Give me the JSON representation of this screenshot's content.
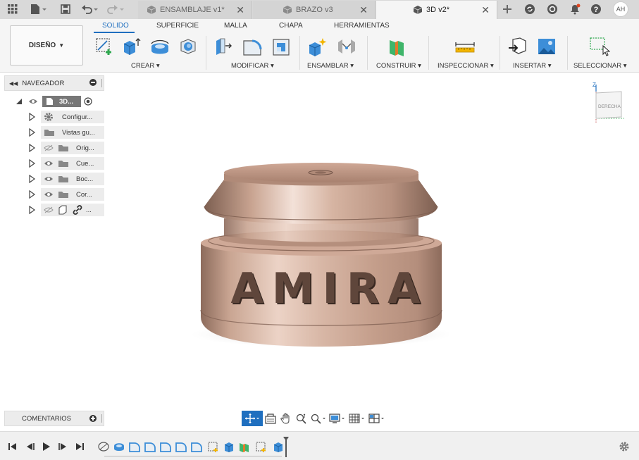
{
  "tabs": [
    {
      "label": "ENSAMBLAJE v1*",
      "active": false
    },
    {
      "label": "BRAZO v3",
      "active": false
    },
    {
      "label": "3D v2*",
      "active": true
    }
  ],
  "user": {
    "initials": "AH"
  },
  "workspace": {
    "label": "DISEÑO"
  },
  "ribbon_tabs": [
    "SOLIDO",
    "SUPERFICIE",
    "MALLA",
    "CHAPA",
    "HERRAMIENTAS"
  ],
  "ribbon_groups": {
    "crear": "CREAR",
    "modificar": "MODIFICAR",
    "ensamblar": "ENSAMBLAR",
    "construir": "CONSTRUIR",
    "inspeccionar": "INSPECCIONAR",
    "insertar": "INSERTAR",
    "seleccionar": "SELECCIONAR"
  },
  "navigator": {
    "title": "NAVEGADOR",
    "root": "3D...",
    "items": [
      {
        "label": "Configur...",
        "icon": "gear-icon"
      },
      {
        "label": "Vistas gu...",
        "icon": "folder-icon"
      },
      {
        "label": "Orig...",
        "icon": "folder-icon"
      },
      {
        "label": "Cue...",
        "icon": "folder-icon"
      },
      {
        "label": "Boc...",
        "icon": "folder-icon"
      },
      {
        "label": "Cor...",
        "icon": "folder-icon"
      },
      {
        "label": "...",
        "icon": "link-icon"
      }
    ]
  },
  "viewcube": {
    "face": "DERECHA",
    "axis": "Z"
  },
  "model": {
    "engraving": "AMIRA"
  },
  "comments": {
    "label": "COMENTARIOS"
  },
  "colors": {
    "accent": "#1f6fbf",
    "bronze_light": "#e8cbbd",
    "bronze_mid": "#c9a592",
    "bronze_dark": "#8d6b5c"
  }
}
